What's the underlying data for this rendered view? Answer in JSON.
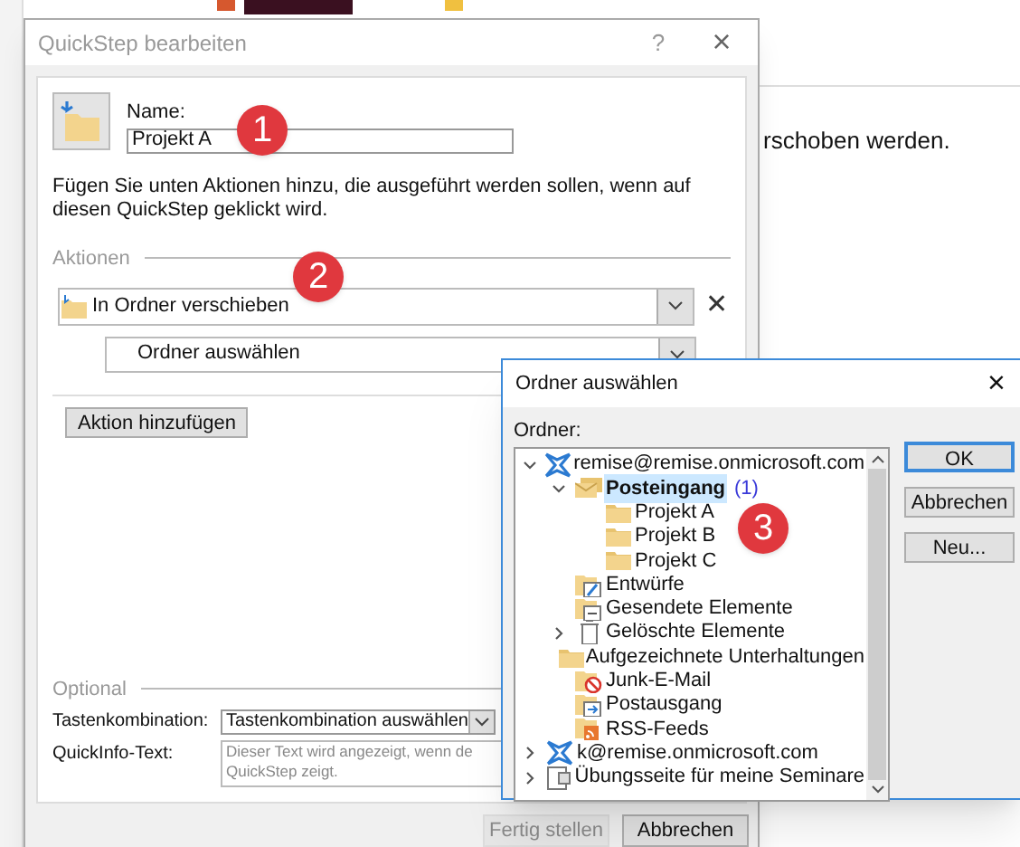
{
  "background": {
    "text": "rschoben werden."
  },
  "main_dialog": {
    "title": "QuickStep bearbeiten",
    "help": "?",
    "close": "×",
    "name_label": "Name:",
    "name_value": "Projekt A",
    "instructions": "Fügen Sie unten Aktionen hinzu, die ausgeführt werden sollen, wenn auf diesen QuickStep geklickt wird.",
    "actions_heading": "Aktionen",
    "action": {
      "value": "In Ordner verschieben",
      "remove": "✕"
    },
    "folder_select": {
      "value": "Ordner auswählen"
    },
    "add_action_button": "Aktion hinzufügen",
    "optional_heading": "Optional",
    "shortcut_label": "Tastenkombination:",
    "shortcut_value": "Tastenkombination auswählen",
    "tooltip_label": "QuickInfo-Text:",
    "tooltip_placeholder": "Dieser Text wird angezeigt, wenn de\nQuickStep zeigt.",
    "buttons": [
      {
        "label": "Fertig stellen",
        "disabled": true
      },
      {
        "label": "Abbrechen",
        "disabled": false
      }
    ]
  },
  "folder_dialog": {
    "title": "Ordner auswählen",
    "close": "×",
    "tree_label": "Ordner:",
    "tree": [
      {
        "kind": "account",
        "label": "remise@remise.onmicrosoft.com",
        "expanded": true,
        "selected": false,
        "children": [
          {
            "kind": "inbox",
            "label": "Posteingang",
            "count": "(1)",
            "expanded": true,
            "selected": true,
            "children": [
              {
                "kind": "folder",
                "label": "Projekt A",
                "selected": false
              },
              {
                "kind": "folder",
                "label": "Projekt B",
                "selected": false
              },
              {
                "kind": "folder",
                "label": "Projekt C",
                "selected": false
              }
            ]
          },
          {
            "kind": "drafts",
            "label": "Entwürfe",
            "selected": false
          },
          {
            "kind": "sent",
            "label": "Gesendete Elemente",
            "selected": false
          },
          {
            "kind": "deleted",
            "label": "Gelöschte Elemente",
            "expanded": false,
            "selected": false
          },
          {
            "kind": "folder",
            "label": "Aufgezeichnete Unterhaltungen",
            "selected": false
          },
          {
            "kind": "junk",
            "label": "Junk-E-Mail",
            "selected": false
          },
          {
            "kind": "outbox",
            "label": "Postausgang",
            "selected": false
          },
          {
            "kind": "rss",
            "label": "RSS-Feeds",
            "selected": false
          }
        ]
      },
      {
        "kind": "account",
        "label": "k@remise.onmicrosoft.com",
        "expanded": false,
        "selected": false
      },
      {
        "kind": "notebook",
        "label": "Übungsseite für meine Seminare",
        "expanded": false,
        "selected": false
      }
    ],
    "buttons": [
      {
        "label": "OK",
        "default": true
      },
      {
        "label": "Abbrechen",
        "default": false
      },
      {
        "label": "Neu...",
        "default": false
      }
    ]
  },
  "callouts": [
    "1",
    "2",
    "3"
  ]
}
